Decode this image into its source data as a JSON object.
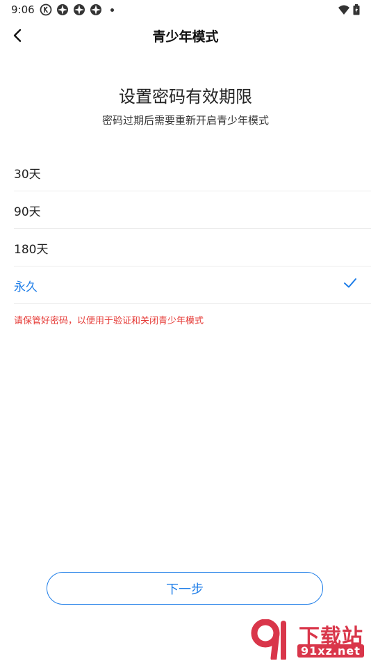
{
  "status_bar": {
    "time": "9:06",
    "left_icons": [
      "k-circle-icon",
      "app-icon",
      "app-icon",
      "app-icon"
    ],
    "right_icons": [
      "wifi-icon",
      "battery-icon"
    ]
  },
  "header": {
    "title": "青少年模式",
    "back_icon": "chevron-left-icon"
  },
  "heading": {
    "title": "设置密码有效期限",
    "subtitle": "密码过期后需要重新开启青少年模式"
  },
  "options": [
    {
      "label": "30天",
      "selected": false
    },
    {
      "label": "90天",
      "selected": false
    },
    {
      "label": "180天",
      "selected": false
    },
    {
      "label": "永久",
      "selected": true
    }
  ],
  "warning": "请保管好密码，以便用于验证和关闭青少年模式",
  "next_button": "下一步",
  "watermark": {
    "main": "下载站",
    "sub": "91xz.net"
  },
  "colors": {
    "accent": "#1f7ee8",
    "warning": "#e53935",
    "watermark": "#d9364a"
  }
}
